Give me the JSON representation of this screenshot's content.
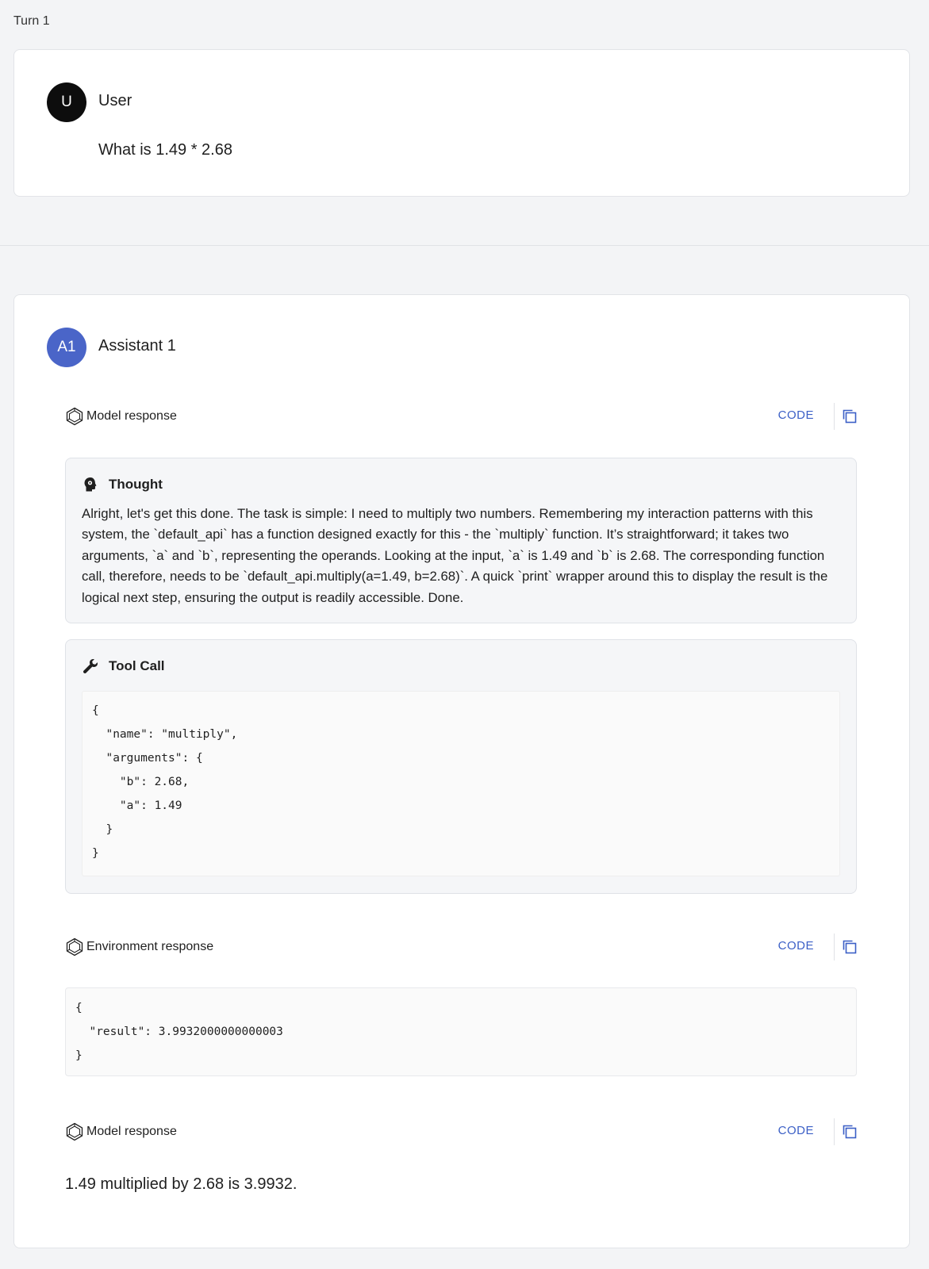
{
  "turn_label": "Turn 1",
  "user": {
    "avatar_letter": "U",
    "name": "User",
    "message": "What is 1.49 * 2.68"
  },
  "assistant": {
    "avatar_letter": "A1",
    "name": "Assistant 1",
    "avatar_color": "#4a65c8"
  },
  "sections": {
    "model_response_1": {
      "title": "Model response",
      "code_label": "CODE",
      "icon": "model-hexagon-icon"
    },
    "thought": {
      "title": "Thought",
      "icon": "brain-head-icon",
      "text": "Alright, let's get this done. The task is simple: I need to multiply two numbers. Remembering my interaction patterns with this system, the `default_api` has a function designed exactly for this - the `multiply` function. It’s straightforward; it takes two arguments, `a` and `b`, representing the operands. Looking at the input, `a` is 1.49 and `b` is 2.68. The corresponding function call, therefore, needs to be `default_api.multiply(a=1.49, b=2.68)`. A quick `print` wrapper around this to display the result is the logical next step, ensuring the output is readily accessible. Done."
    },
    "tool_call": {
      "title": "Tool Call",
      "icon": "wrench-icon",
      "code": "{\n  \"name\": \"multiply\",\n  \"arguments\": {\n    \"b\": 2.68,\n    \"a\": 1.49\n  }\n}"
    },
    "environment_response": {
      "title": "Environment response",
      "code_label": "CODE",
      "icon": "model-hexagon-icon",
      "code": "{\n  \"result\": 3.9932000000000003\n}"
    },
    "model_response_2": {
      "title": "Model response",
      "code_label": "CODE",
      "icon": "model-hexagon-icon",
      "text": "1.49 multiplied by 2.68 is 3.9932."
    }
  },
  "colors": {
    "accent": "#3b5fc6",
    "background": "#f3f4f6",
    "card": "#ffffff"
  }
}
